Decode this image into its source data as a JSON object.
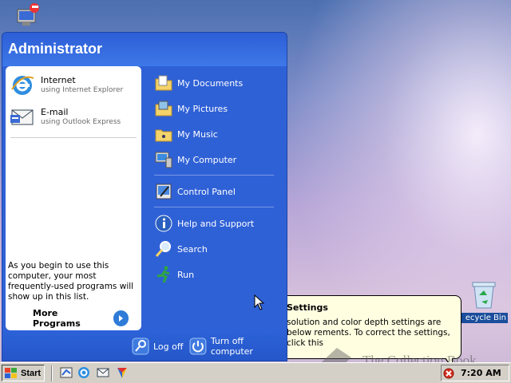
{
  "start_menu": {
    "user_name": "Administrator",
    "pinned": [
      {
        "title": "Internet",
        "subtitle": "using Internet Explorer",
        "icon": "internet-explorer-icon"
      },
      {
        "title": "E-mail",
        "subtitle": "using Outlook Express",
        "icon": "outlook-express-icon"
      }
    ],
    "hint": "As you begin to use this computer, your most frequently-used programs will show up in this list.",
    "more_programs": "More Programs",
    "right_items": [
      {
        "label": "My Documents",
        "icon": "folder-documents-icon"
      },
      {
        "label": "My Pictures",
        "icon": "folder-pictures-icon"
      },
      {
        "label": "My Music",
        "icon": "folder-music-icon"
      },
      {
        "label": "My Computer",
        "icon": "my-computer-icon"
      },
      {
        "label": "Control Panel",
        "icon": "control-panel-icon"
      },
      {
        "label": "Help and Support",
        "icon": "help-icon"
      },
      {
        "label": "Search",
        "icon": "search-icon"
      },
      {
        "label": "Run",
        "icon": "run-icon"
      }
    ],
    "log_off": "Log off",
    "turn_off": "Turn off computer"
  },
  "balloon": {
    "title": "Settings",
    "body": "solution and color depth settings are below rements. To correct the settings, click this"
  },
  "desktop": {
    "recycle_bin_label": "ecycle Bin"
  },
  "watermark": "The Collection Book",
  "taskbar": {
    "start_label": "Start",
    "clock": "7:20 AM"
  },
  "colors": {
    "menu_blue": "#2f61d6",
    "tray_bg": "#d4d0c8",
    "balloon_bg": "#fffee1"
  }
}
